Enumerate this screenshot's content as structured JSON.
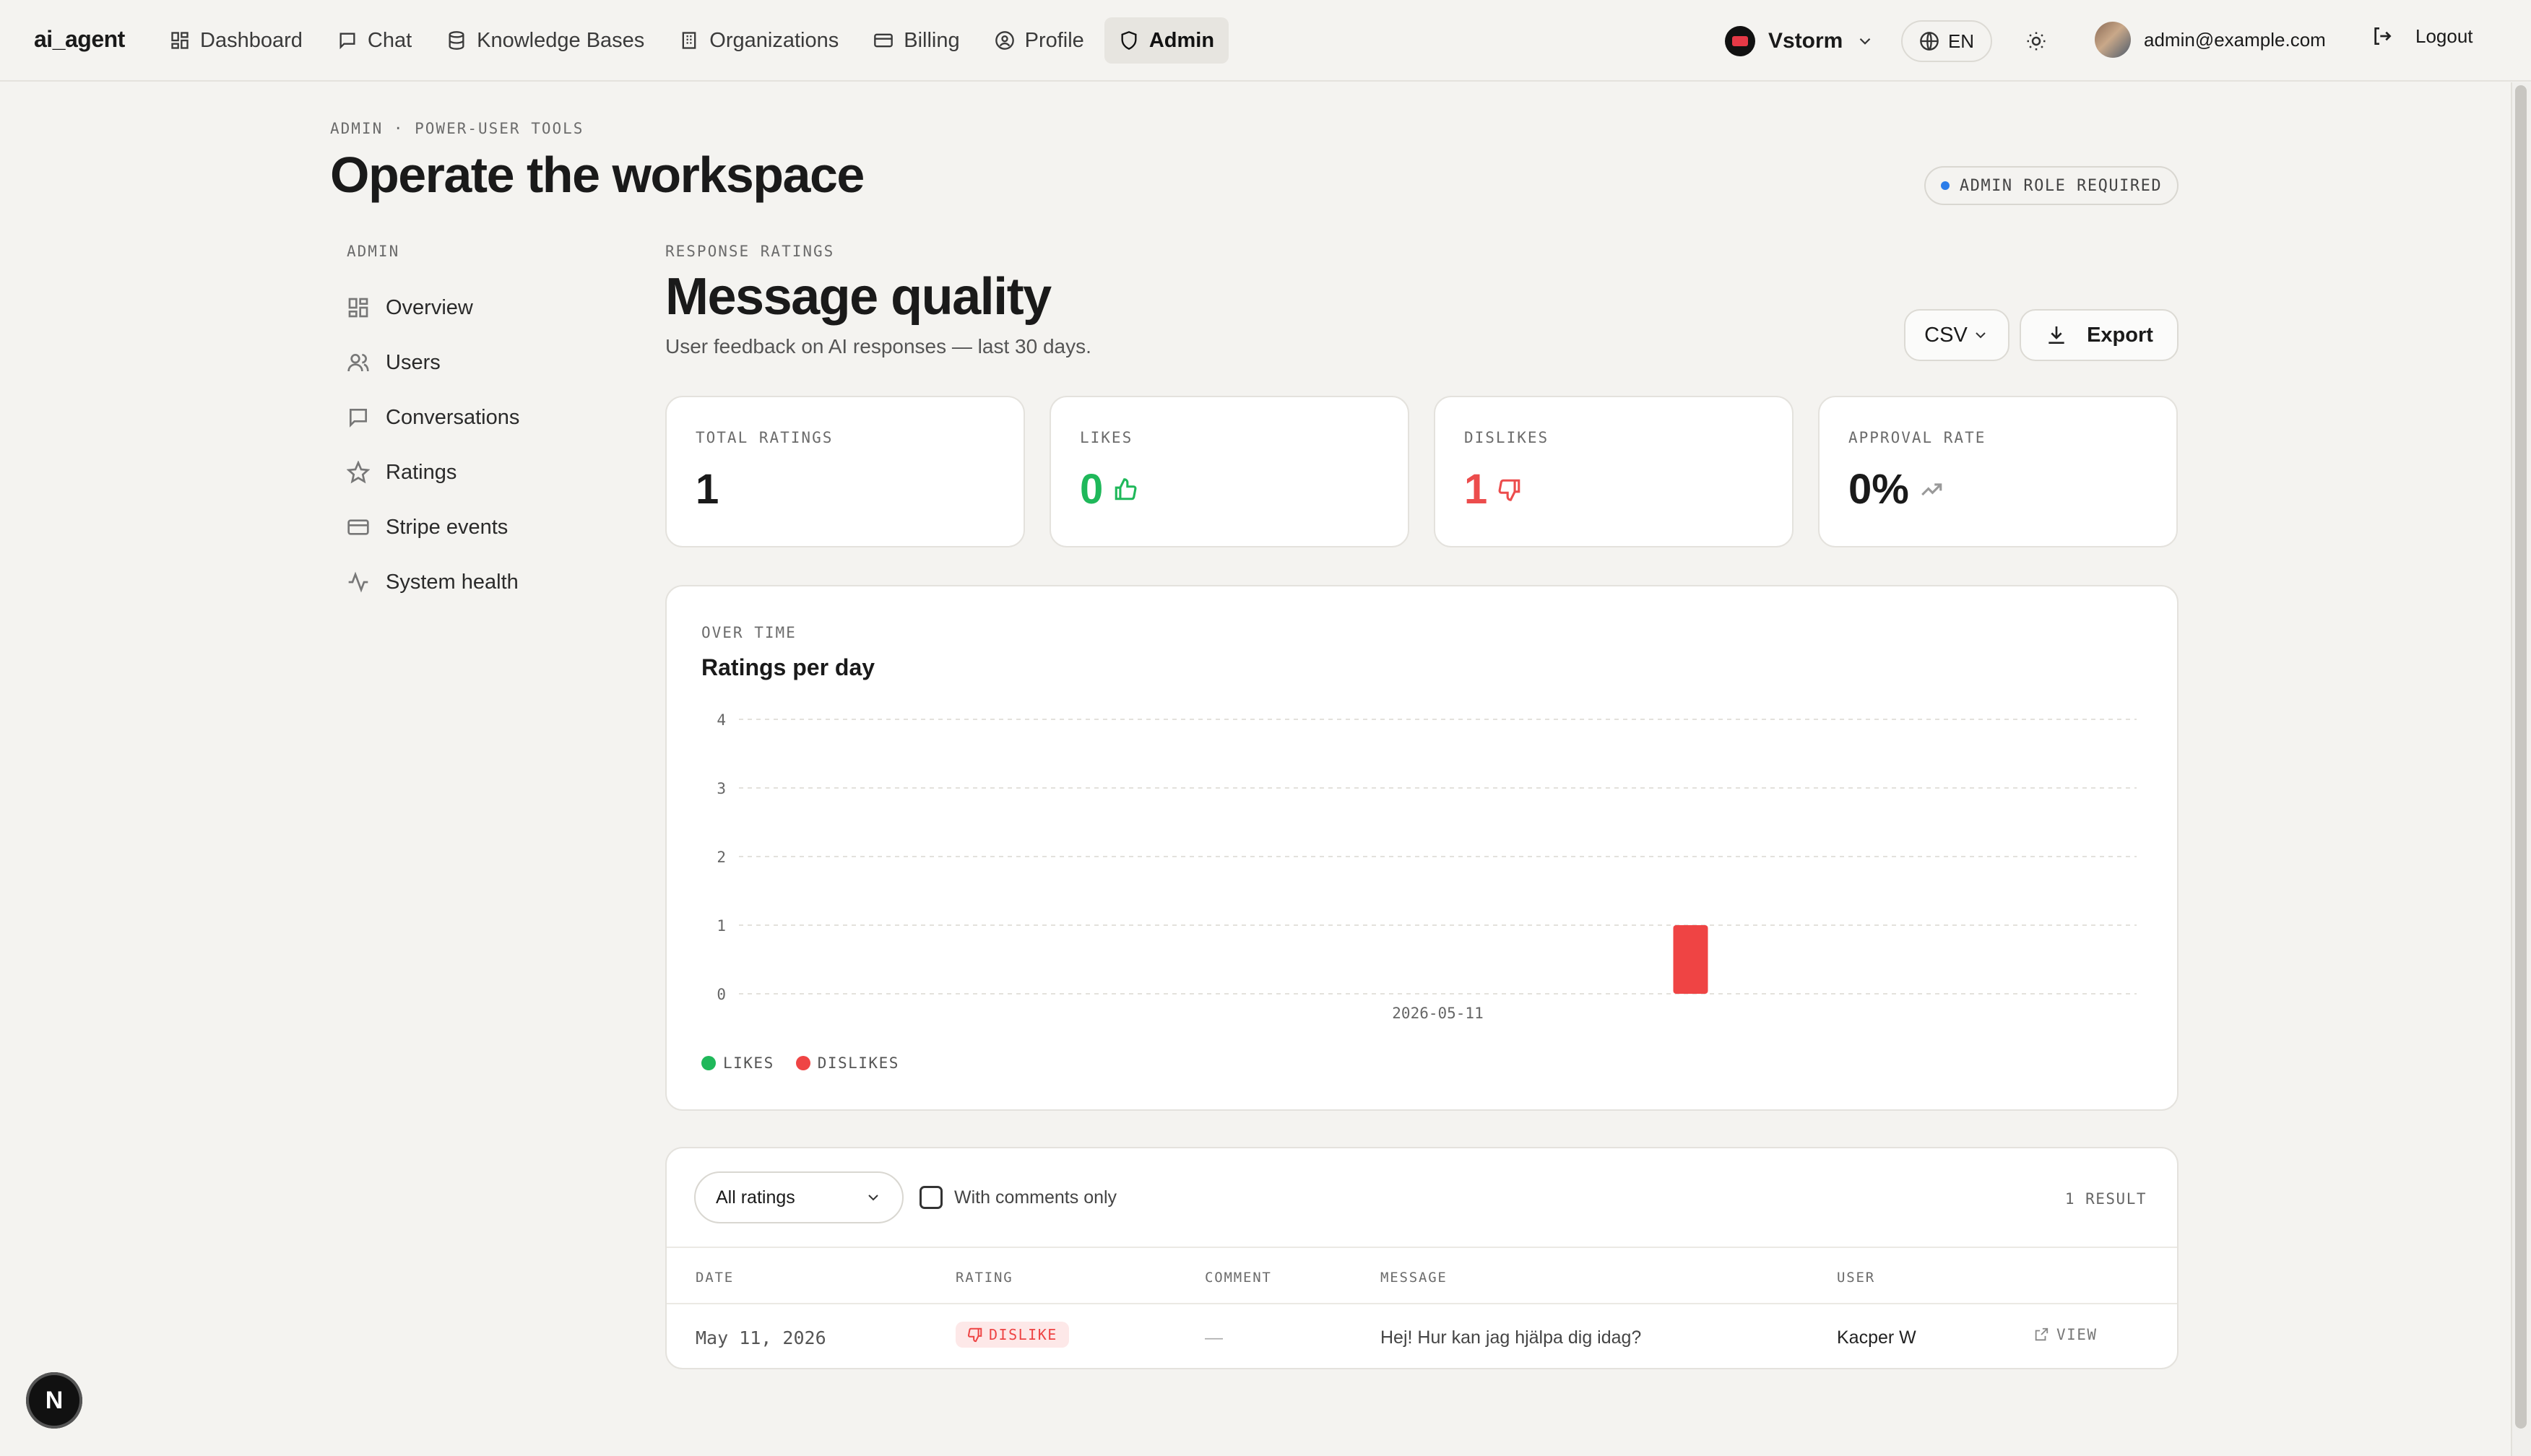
{
  "brand": "ai_agent",
  "nav": [
    {
      "label": "Dashboard",
      "icon": "grid-icon"
    },
    {
      "label": "Chat",
      "icon": "chat-icon"
    },
    {
      "label": "Knowledge Bases",
      "icon": "database-icon"
    },
    {
      "label": "Organizations",
      "icon": "building-icon"
    },
    {
      "label": "Billing",
      "icon": "card-icon"
    },
    {
      "label": "Profile",
      "icon": "user-circle-icon"
    },
    {
      "label": "Admin",
      "icon": "shield-icon",
      "active": true
    }
  ],
  "org": {
    "name": "Vstorm"
  },
  "language": "EN",
  "user": {
    "email": "admin@example.com"
  },
  "logout_label": "Logout",
  "page": {
    "eyebrow": "ADMIN · POWER-USER TOOLS",
    "title": "Operate the workspace",
    "role_pill": "ADMIN ROLE REQUIRED"
  },
  "sidebar": {
    "label": "ADMIN",
    "items": [
      {
        "label": "Overview",
        "icon": "grid-icon"
      },
      {
        "label": "Users",
        "icon": "users-icon"
      },
      {
        "label": "Conversations",
        "icon": "chat-icon"
      },
      {
        "label": "Ratings",
        "icon": "star-icon"
      },
      {
        "label": "Stripe events",
        "icon": "card-icon"
      },
      {
        "label": "System health",
        "icon": "activity-icon"
      }
    ]
  },
  "section": {
    "eyebrow": "RESPONSE RATINGS",
    "title": "Message quality",
    "subtitle": "User feedback on AI responses — last 30 days.",
    "format": "CSV",
    "export_label": "Export"
  },
  "stats": [
    {
      "label": "TOTAL RATINGS",
      "value": "1"
    },
    {
      "label": "LIKES",
      "value": "0"
    },
    {
      "label": "DISLIKES",
      "value": "1"
    },
    {
      "label": "APPROVAL RATE",
      "value": "0%"
    }
  ],
  "chart": {
    "eyebrow": "OVER TIME",
    "title": "Ratings per day"
  },
  "chart_data": {
    "type": "bar",
    "categories": [
      "2026-05-11"
    ],
    "series": [
      {
        "name": "LIKES",
        "values": [
          0
        ],
        "color": "#1fb85a"
      },
      {
        "name": "DISLIKES",
        "values": [
          1
        ],
        "color": "#ef4444"
      }
    ],
    "yticks": [
      "0",
      "1",
      "2",
      "3",
      "4"
    ],
    "ylim": [
      0,
      4
    ],
    "grid": true,
    "legend": "bottom-left",
    "title": "Ratings per day",
    "xlabel": "",
    "ylabel": ""
  },
  "table": {
    "filter": "All ratings",
    "comments_only_label": "With comments only",
    "result_count": "1 RESULT",
    "columns": [
      "DATE",
      "RATING",
      "COMMENT",
      "MESSAGE",
      "USER"
    ],
    "rows": [
      {
        "date": "May 11, 2026",
        "rating": "DISLIKE",
        "comment": "—",
        "message": "Hej! Hur kan jag hjälpa dig idag?",
        "user": "Kacper W",
        "action": "VIEW"
      }
    ]
  },
  "colors": {
    "like": "#1fb85a",
    "dislike": "#ef4444",
    "accent": "#2b7de9"
  }
}
